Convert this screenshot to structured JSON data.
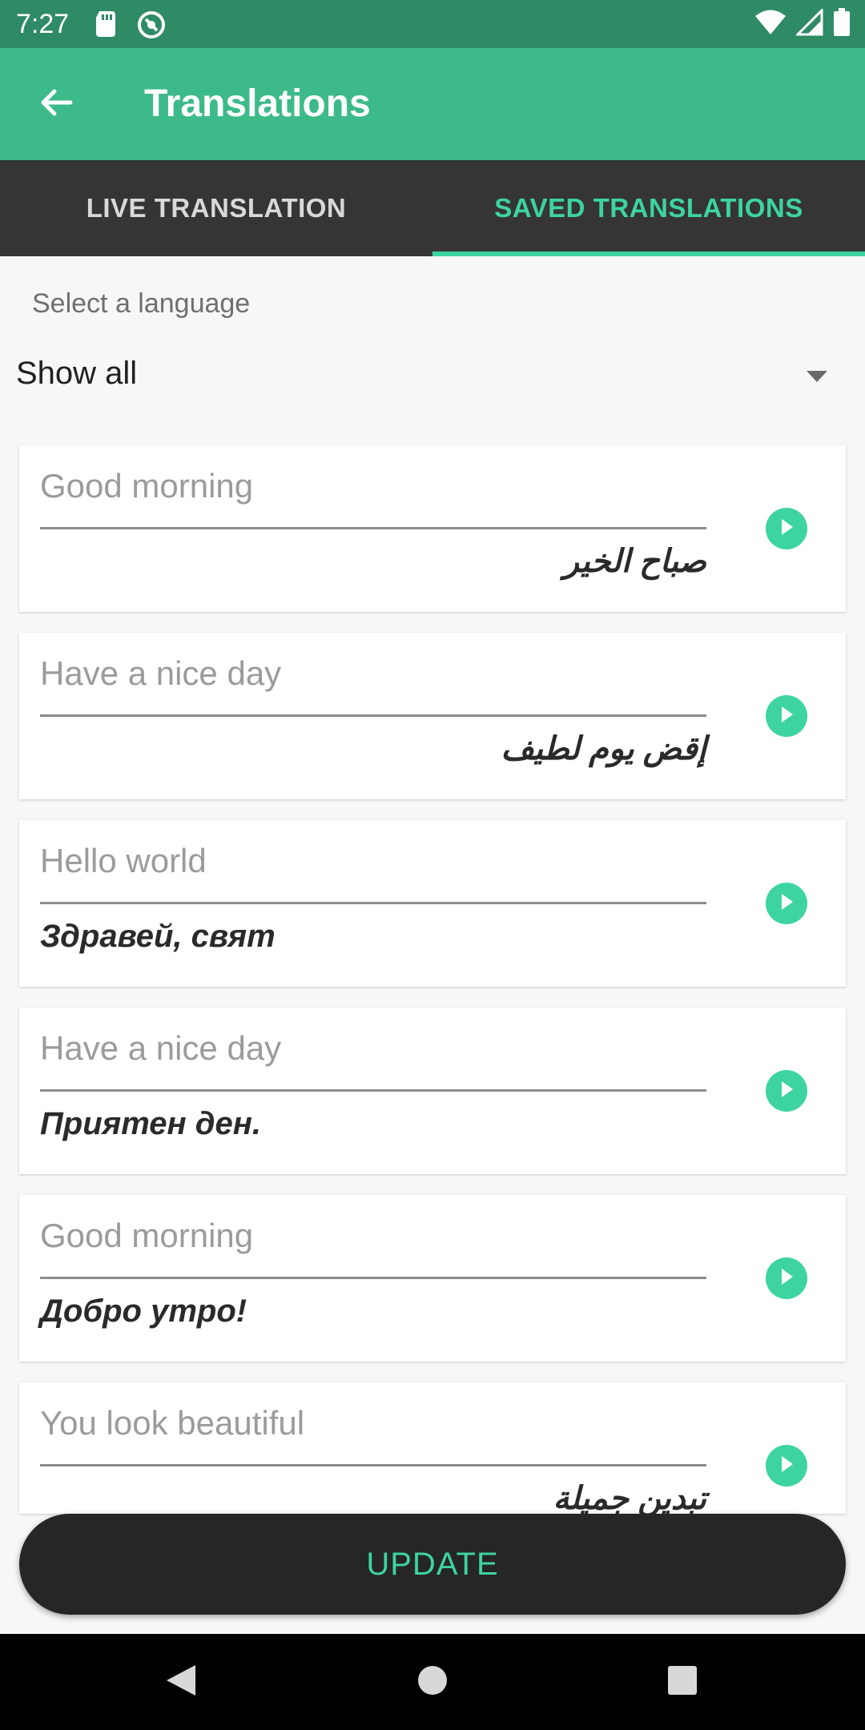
{
  "status_bar": {
    "time": "7:27",
    "icons": [
      "sd-card-icon",
      "sync-icon",
      "wifi-icon",
      "signal-icon",
      "battery-icon"
    ]
  },
  "app_bar": {
    "title": "Translations",
    "back_icon": "arrow-back-icon",
    "color": "#3dba89"
  },
  "tabs": [
    {
      "label": "LIVE TRANSLATION",
      "selected": false
    },
    {
      "label": "SAVED TRANSLATIONS",
      "selected": true
    }
  ],
  "language_selector": {
    "label": "Select a language",
    "value": "Show all"
  },
  "translations": [
    {
      "source": "Good morning",
      "translation": "صباح الخير",
      "direction": "rtl"
    },
    {
      "source": "Have a nice day",
      "translation": "إقض يوم لطيف",
      "direction": "rtl"
    },
    {
      "source": "Hello world",
      "translation": "Здравей, свят",
      "direction": "ltr"
    },
    {
      "source": "Have a nice day",
      "translation": "Приятен ден.",
      "direction": "ltr"
    },
    {
      "source": "Good morning",
      "translation": "Добро утро!",
      "direction": "ltr"
    },
    {
      "source": "You look beautiful",
      "translation": "تبدين جميلة",
      "direction": "rtl"
    }
  ],
  "update_button": {
    "label": "UPDATE"
  },
  "colors": {
    "accent": "#3dd4a0",
    "status_bar": "#2f8a66",
    "tab_bar": "#353535"
  }
}
